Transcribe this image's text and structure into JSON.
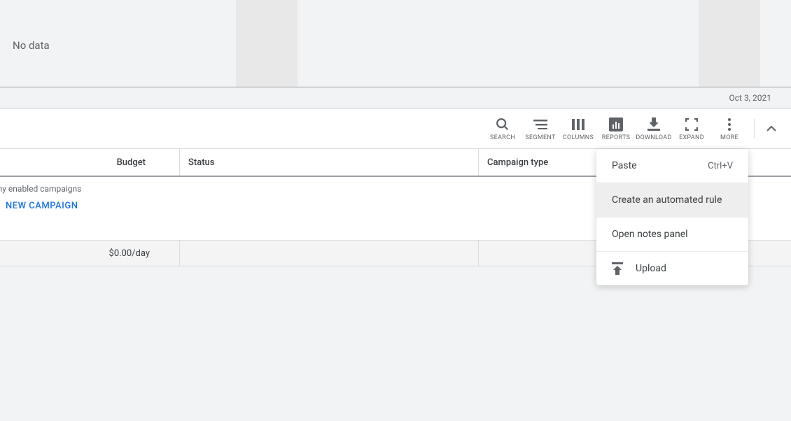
{
  "chart": {
    "title": "No data"
  },
  "date_label": "Oct 3, 2021",
  "toolbar": {
    "search": "SEARCH",
    "segment": "SEGMENT",
    "columns": "COLUMNS",
    "reports": "REPORTS",
    "download": "DOWNLOAD",
    "expand": "EXPAND",
    "more": "MORE"
  },
  "table": {
    "headers": {
      "budget": "Budget",
      "status": "Status",
      "campaign_type": "Campaign type"
    },
    "empty_message": "have any enabled campaigns",
    "new_campaign_label": "NEW CAMPAIGN",
    "summary_budget": "$0.00/day"
  },
  "menu": {
    "paste": "Paste",
    "paste_shortcut": "Ctrl+V",
    "automated_rule": "Create an automated rule",
    "notes_panel": "Open notes panel",
    "upload": "Upload"
  }
}
